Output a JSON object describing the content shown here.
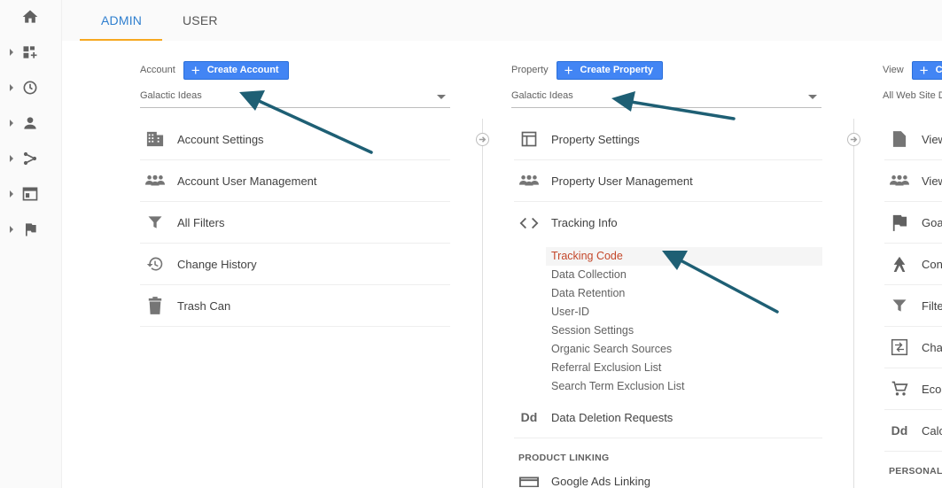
{
  "tabs": [
    {
      "label": "ADMIN",
      "active": true
    },
    {
      "label": "USER",
      "active": false
    }
  ],
  "leftnav": {
    "icons": [
      "home-icon",
      "customization-icon",
      "realtime-icon",
      "audience-icon",
      "acquisition-icon",
      "behavior-icon",
      "conversions-icon"
    ]
  },
  "account": {
    "label": "Account",
    "create_label": "Create Account",
    "selected": "Galactic Ideas",
    "items": [
      {
        "label": "Account Settings",
        "icon": "building-icon"
      },
      {
        "label": "Account User Management",
        "icon": "people-icon"
      },
      {
        "label": "All Filters",
        "icon": "filter-icon"
      },
      {
        "label": "Change History",
        "icon": "history-icon"
      },
      {
        "label": "Trash Can",
        "icon": "trash-icon"
      }
    ]
  },
  "property": {
    "label": "Property",
    "create_label": "Create Property",
    "selected": "Galactic Ideas",
    "items": [
      {
        "label": "Property Settings",
        "icon": "window-icon"
      },
      {
        "label": "Property User Management",
        "icon": "people-icon"
      },
      {
        "label": "Tracking Info",
        "icon": "code-icon"
      }
    ],
    "tracking_sub": [
      {
        "label": "Tracking Code",
        "selected": true
      },
      {
        "label": "Data Collection",
        "selected": false
      },
      {
        "label": "Data Retention",
        "selected": false
      },
      {
        "label": "User-ID",
        "selected": false
      },
      {
        "label": "Session Settings",
        "selected": false
      },
      {
        "label": "Organic Search Sources",
        "selected": false
      },
      {
        "label": "Referral Exclusion List",
        "selected": false
      },
      {
        "label": "Search Term Exclusion List",
        "selected": false
      }
    ],
    "deletion": {
      "label": "Data Deletion Requests",
      "icon_text": "Dd"
    },
    "product_linking_label": "PRODUCT LINKING",
    "ads_linking": "Google Ads Linking"
  },
  "view": {
    "label": "View",
    "create_label": "C",
    "selected": "All Web Site D",
    "items": [
      {
        "label": "View",
        "icon": "document-icon"
      },
      {
        "label": "View",
        "icon": "people-icon"
      },
      {
        "label": "Goa",
        "icon": "flag-icon"
      },
      {
        "label": "Con",
        "icon": "content-grouping-icon"
      },
      {
        "label": "Filte",
        "icon": "filter-icon"
      },
      {
        "label": "Cha",
        "icon": "channel-settings-icon"
      },
      {
        "label": "Ecor",
        "icon": "cart-icon"
      },
      {
        "label": "Calc",
        "icon": "calculated-metrics-icon",
        "icon_text": "Dd"
      }
    ],
    "personal_label": "PERSONAL T"
  },
  "colors": {
    "accent_blue": "#4285f4",
    "tab_underline": "#f6a821",
    "selected_red": "#c4472a",
    "arrow_teal": "#1e5f74"
  }
}
